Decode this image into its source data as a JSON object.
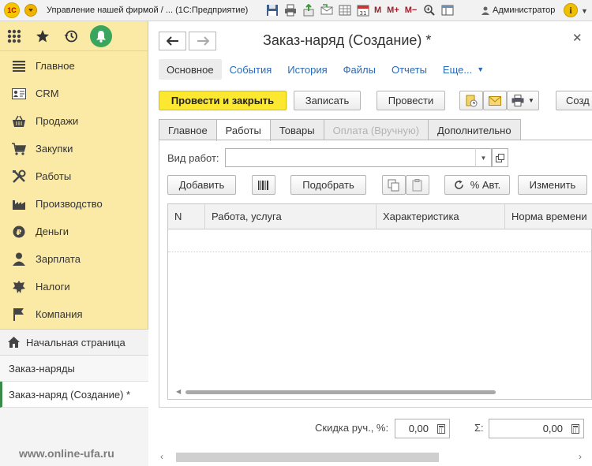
{
  "titlebar": {
    "app_title": "Управление нашей фирмой / ... (1С:Предприятие)",
    "logo_text": "1С",
    "m_buttons": [
      "M",
      "M+",
      "M−"
    ],
    "user": "Администратор",
    "info": "i"
  },
  "sidebar": {
    "items": [
      {
        "label": "Главное",
        "icon": "menu-lines-icon"
      },
      {
        "label": "CRM",
        "icon": "contact-card-icon"
      },
      {
        "label": "Продажи",
        "icon": "shopping-basket-icon"
      },
      {
        "label": "Закупки",
        "icon": "cart-icon"
      },
      {
        "label": "Работы",
        "icon": "tools-icon"
      },
      {
        "label": "Производство",
        "icon": "factory-icon"
      },
      {
        "label": "Деньги",
        "icon": "ruble-coin-icon"
      },
      {
        "label": "Зарплата",
        "icon": "person-icon"
      },
      {
        "label": "Налоги",
        "icon": "emblem-icon"
      },
      {
        "label": "Компания",
        "icon": "flag-icon"
      }
    ],
    "home": "Начальная страница",
    "open_windows": [
      "Заказ-наряды",
      "Заказ-наряд (Создание) *"
    ]
  },
  "watermark": "www.online-ufa.ru",
  "form": {
    "title": "Заказ-наряд (Создание) *",
    "nav_tabs": [
      "Основное",
      "События",
      "История",
      "Файлы",
      "Отчеты",
      "Еще..."
    ],
    "buttons": {
      "post_close": "Провести и закрыть",
      "save": "Записать",
      "post": "Провести",
      "create_on_basis": "Созд"
    },
    "inner_tabs": [
      "Главное",
      "Работы",
      "Товары",
      "Оплата (Вручную)",
      "Дополнительно"
    ],
    "work_type_label": "Вид работ:",
    "work_type_value": "",
    "table_buttons": {
      "add": "Добавить",
      "select": "Подобрать",
      "auto_percent": "% Авт.",
      "change": "Изменить"
    },
    "columns": [
      "N",
      "Работа, услуга",
      "Характеристика",
      "Норма времени"
    ],
    "discount_label": "Скидка руч., %:",
    "discount_value": "0,00",
    "sum_label": "Σ:",
    "sum_value": "0,00"
  },
  "colors": {
    "sidebar_bg": "#fbeaa5",
    "primary_button": "#fce830",
    "link": "#2a6bb8",
    "notification": "#3aa55c"
  }
}
